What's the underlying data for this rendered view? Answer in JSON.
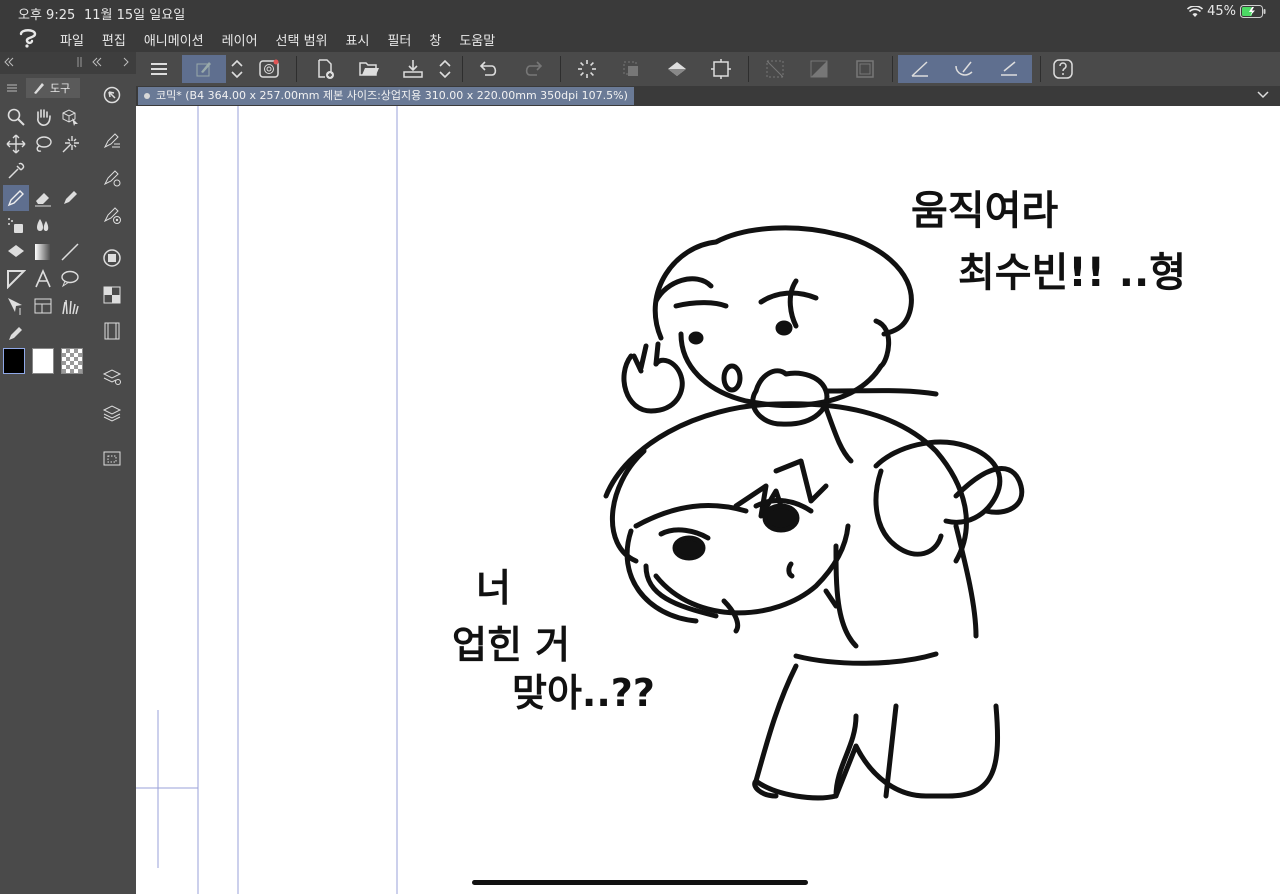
{
  "status_bar": {
    "time": "오후 9:25",
    "date": "11월 15일 일요일",
    "battery": "45%"
  },
  "menu": {
    "items": [
      "파일",
      "편집",
      "애니메이션",
      "레이어",
      "선택 범위",
      "표시",
      "필터",
      "창",
      "도움말"
    ]
  },
  "tool_panel": {
    "tab_label": "도구"
  },
  "document": {
    "tab_title": "코믹* (B4 364.00 x 257.00mm 제본 사이즈:상업지용 310.00 x 220.00mm 350dpi 107.5%)"
  },
  "canvas_text": {
    "top_right_line1": "움직여라",
    "top_right_line2": "최수빈!! ..형",
    "bottom_left_line1": "너",
    "bottom_left_line2": "업힌 거",
    "bottom_left_line3": "맞아..??"
  },
  "colors": {
    "toolbar_bg": "#4a4a4a",
    "active_tool": "#5f6f8f",
    "doc_tab": "#6a7a96",
    "guide_line": "#9aa0d8",
    "battery": "#4cd964"
  },
  "icons": [
    "app-logo-icon",
    "menu-icon",
    "brush-settings-icon",
    "up-down-icon",
    "companion-icon",
    "new-file-icon",
    "open-file-icon",
    "save-icon",
    "undo-icon",
    "redo-icon",
    "loading-icon",
    "clear-selection-icon",
    "fill-icon",
    "transform-icon",
    "ruler-icon",
    "help-icon",
    "search-icon",
    "hand-icon",
    "lasso-icon",
    "move-icon",
    "eyedropper-icon",
    "pen-icon",
    "eraser-icon",
    "text-icon",
    "layers-icon",
    "filmstrip-icon",
    "wifi-icon",
    "battery-icon"
  ]
}
